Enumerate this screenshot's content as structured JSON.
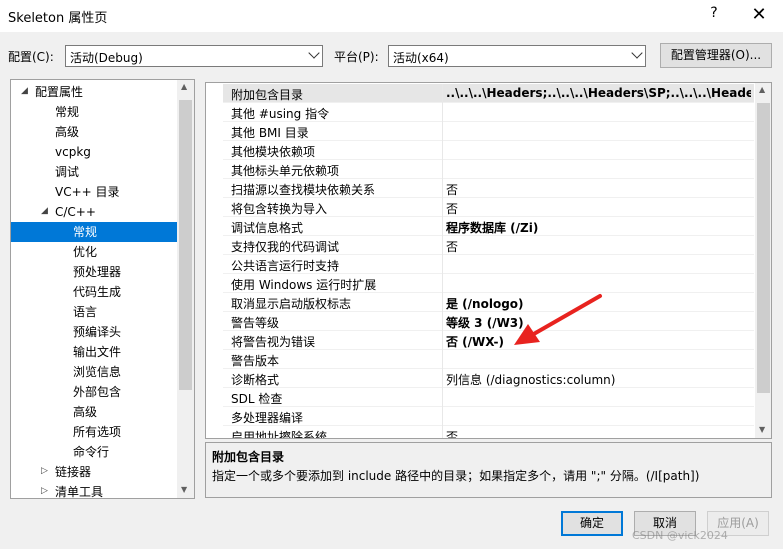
{
  "window": {
    "title": "Skeleton 属性页",
    "help": "?",
    "close": "✕"
  },
  "toolbar": {
    "config_label": "配置(C):",
    "config_value": "活动(Debug)",
    "platform_label": "平台(P):",
    "platform_value": "活动(x64)",
    "config_manager": "配置管理器(O)..."
  },
  "tree": {
    "items": [
      {
        "label": "配置属性",
        "twisty": "◢"
      },
      {
        "label": "常规"
      },
      {
        "label": "高级"
      },
      {
        "label": "vcpkg"
      },
      {
        "label": "调试"
      },
      {
        "label": "VC++ 目录"
      },
      {
        "label": "C/C++",
        "twisty": "◢"
      },
      {
        "label": "常规"
      },
      {
        "label": "优化"
      },
      {
        "label": "预处理器"
      },
      {
        "label": "代码生成"
      },
      {
        "label": "语言"
      },
      {
        "label": "预编译头"
      },
      {
        "label": "输出文件"
      },
      {
        "label": "浏览信息"
      },
      {
        "label": "外部包含"
      },
      {
        "label": "高级"
      },
      {
        "label": "所有选项"
      },
      {
        "label": "命令行"
      },
      {
        "label": "链接器",
        "twisty": "▷"
      },
      {
        "label": "清单工具",
        "twisty": "▷"
      }
    ],
    "scroll_up": "▲",
    "scroll_down": "▼"
  },
  "grid": {
    "rows": [
      {
        "name": "附加包含目录",
        "value": "..\\..\\..\\Headers;..\\..\\..\\Headers\\SP;..\\..\\..\\Headers\\Wi",
        "bold": true
      },
      {
        "name": "其他 #using 指令",
        "value": ""
      },
      {
        "name": "其他 BMI 目录",
        "value": ""
      },
      {
        "name": "其他模块依赖项",
        "value": ""
      },
      {
        "name": "其他标头单元依赖项",
        "value": ""
      },
      {
        "name": "扫描源以查找模块依赖关系",
        "value": "否"
      },
      {
        "name": "将包含转换为导入",
        "value": "否"
      },
      {
        "name": "调试信息格式",
        "value": "程序数据库 (/Zi)",
        "bold": true
      },
      {
        "name": "支持仅我的代码调试",
        "value": "否"
      },
      {
        "name": "公共语言运行时支持",
        "value": ""
      },
      {
        "name": "使用 Windows 运行时扩展",
        "value": ""
      },
      {
        "name": "取消显示启动版权标志",
        "value": "是 (/nologo)",
        "bold": true
      },
      {
        "name": "警告等级",
        "value": "等级 3 (/W3)",
        "bold": true
      },
      {
        "name": "将警告视为错误",
        "value": "否 (/WX-)",
        "bold": true
      },
      {
        "name": "警告版本",
        "value": ""
      },
      {
        "name": "诊断格式",
        "value": "列信息 (/diagnostics:column)"
      },
      {
        "name": "SDL 检查",
        "value": ""
      },
      {
        "name": "多处理器编译",
        "value": ""
      },
      {
        "name": "启用地址擦除系统",
        "value": "否"
      }
    ],
    "scroll_up": "▲",
    "scroll_down": "▼"
  },
  "description": {
    "title": "附加包含目录",
    "text": "指定一个或多个要添加到 include 路径中的目录；如果指定多个，请用 \";\" 分隔。(/I[path])"
  },
  "buttons": {
    "ok": "确定",
    "cancel": "取消",
    "apply": "应用(A)"
  },
  "watermark": "CSDN @vick2024",
  "colors": {
    "selection": "#0078d7",
    "annotation_arrow": "#e8231f"
  }
}
